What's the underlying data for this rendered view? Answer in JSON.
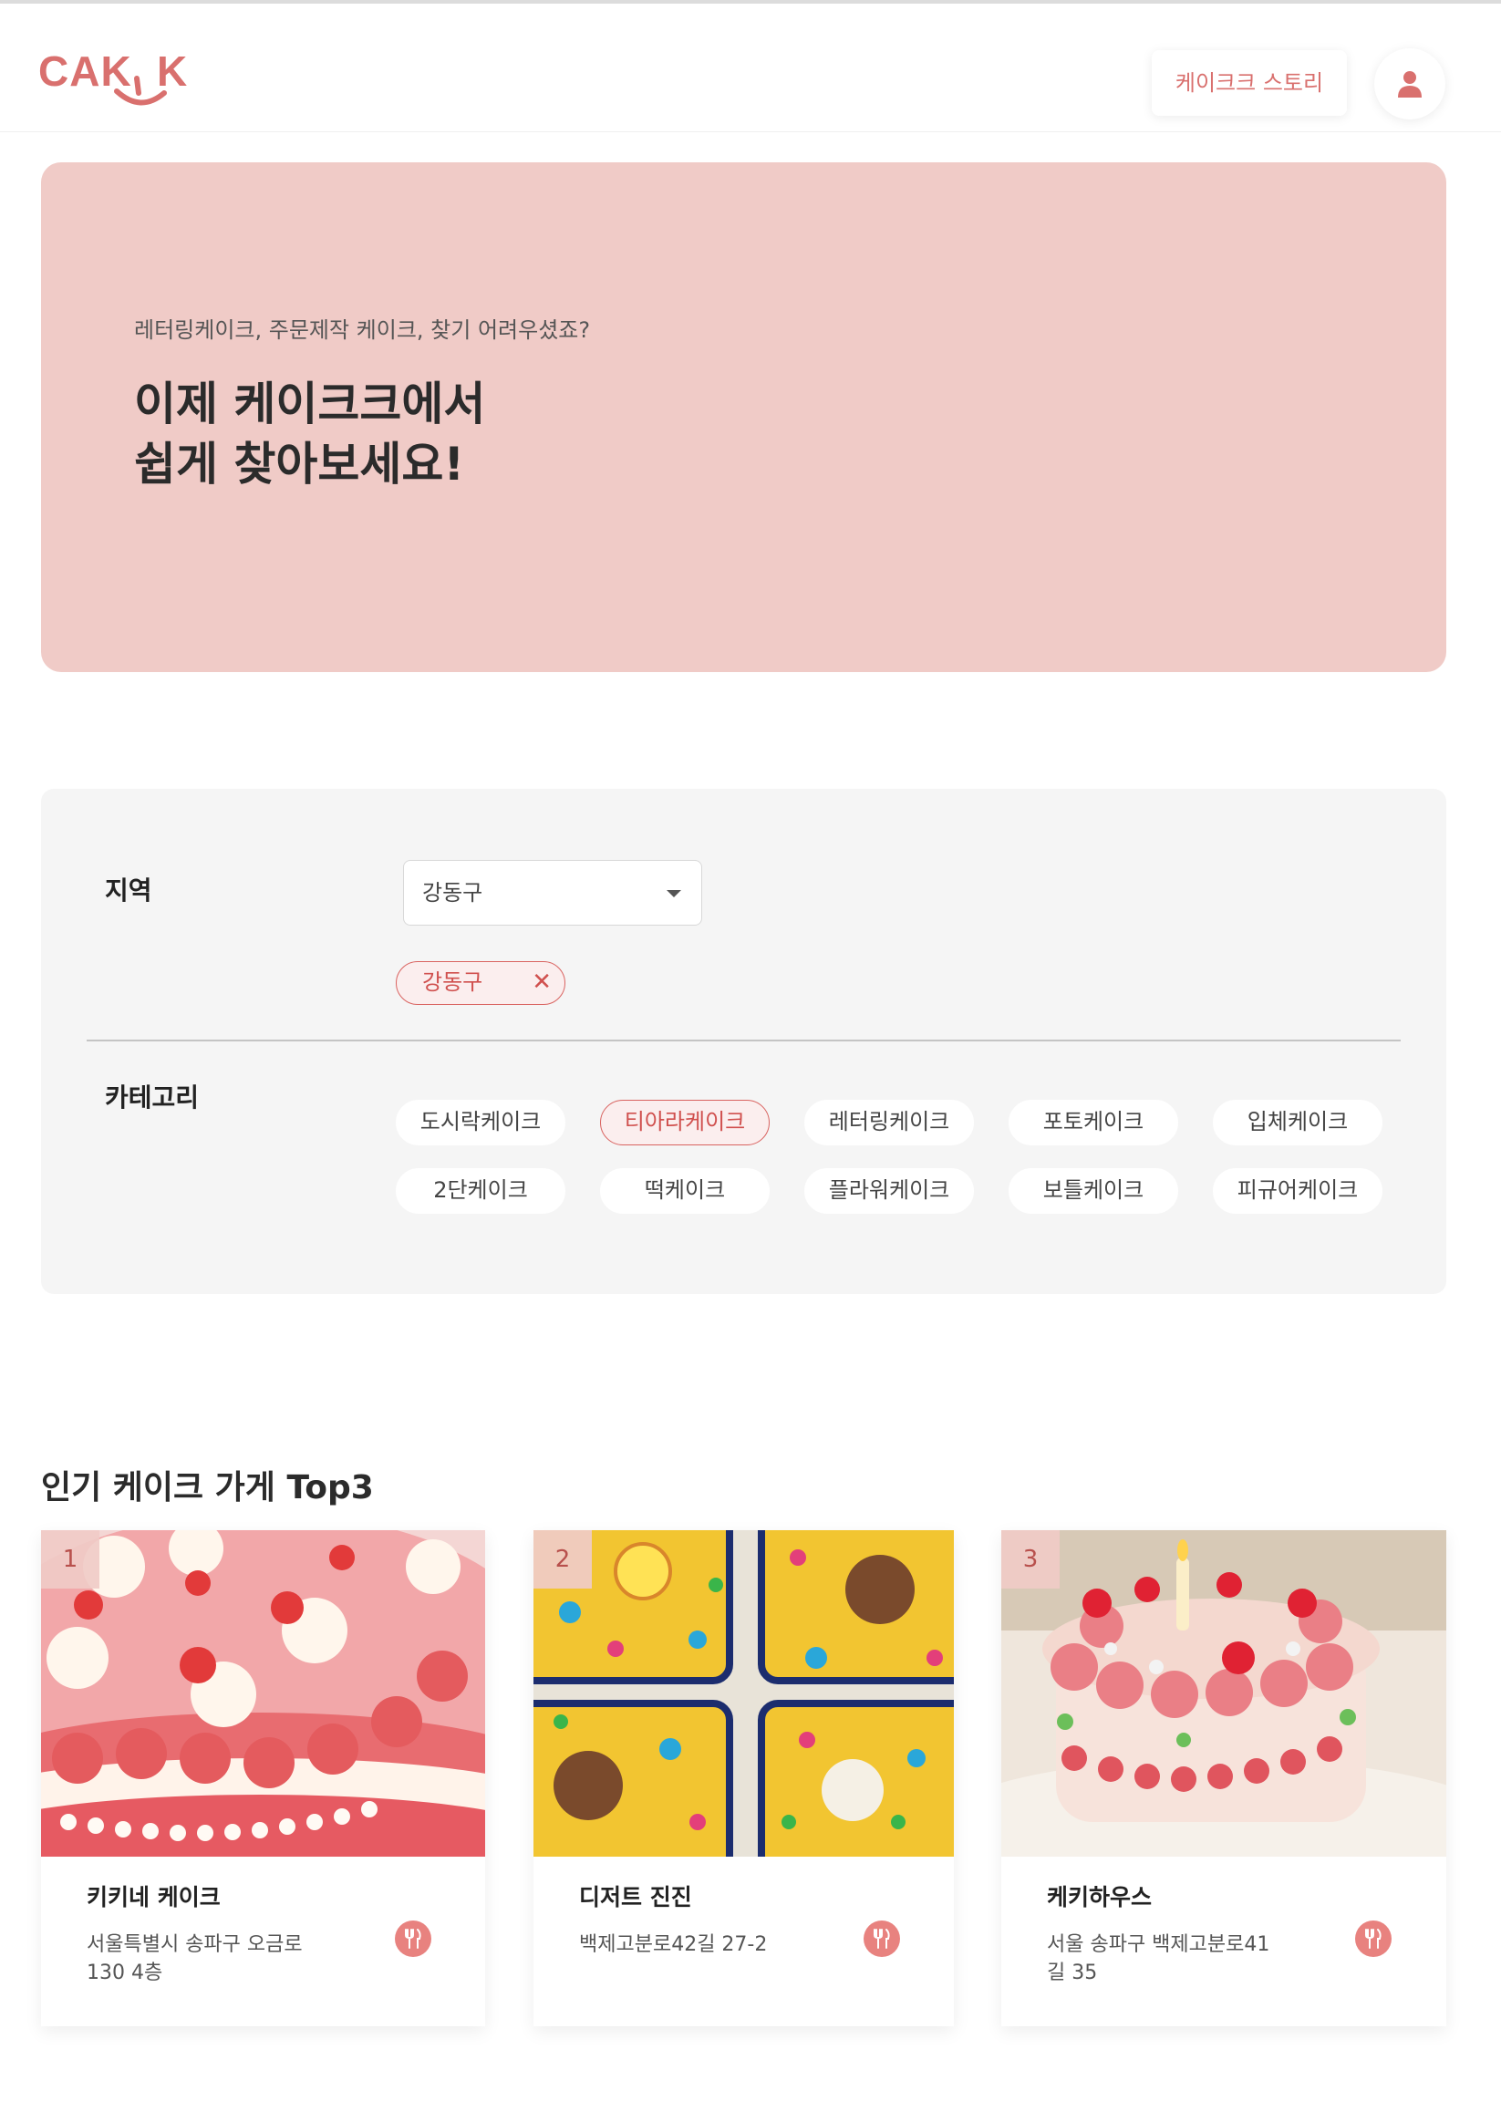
{
  "header": {
    "logo_text": "CAKEK",
    "story_button": "케이크크 스토리",
    "profile_icon": "user-icon"
  },
  "hero": {
    "subtitle": "레터링케이크, 주문제작 케이크, 찾기 어려우셨죠?",
    "title_line1": "이제 케이크크에서",
    "title_line2": "쉽게 찾아보세요!"
  },
  "filter": {
    "region_label": "지역",
    "region_select": {
      "value": "강동구",
      "icon": "chevron-down-icon"
    },
    "selected_regions": [
      {
        "label": "강동구",
        "remove_icon": "close-icon"
      }
    ],
    "category_label": "카테고리",
    "categories": [
      {
        "label": "도시락케이크",
        "selected": false
      },
      {
        "label": "티아라케이크",
        "selected": true
      },
      {
        "label": "레터링케이크",
        "selected": false
      },
      {
        "label": "포토케이크",
        "selected": false
      },
      {
        "label": "입체케이크",
        "selected": false
      },
      {
        "label": "2단케이크",
        "selected": false
      },
      {
        "label": "떡케이크",
        "selected": false
      },
      {
        "label": "플라워케이크",
        "selected": false
      },
      {
        "label": "보틀케이크",
        "selected": false
      },
      {
        "label": "피규어케이크",
        "selected": false
      }
    ]
  },
  "top3": {
    "title": "인기 케이크 가게 Top3",
    "stores": [
      {
        "rank": "1",
        "name": "키키네 케이크",
        "address": "서울특별시 송파구 오금로 130 4층",
        "icon": "fork-knife-icon"
      },
      {
        "rank": "2",
        "name": "디저트 진진",
        "address": "백제고분로42길 27-2",
        "icon": "fork-knife-icon"
      },
      {
        "rank": "3",
        "name": "케키하우스",
        "address": "서울 송파구 백제고분로41길 35",
        "icon": "fork-knife-icon"
      }
    ]
  },
  "colors": {
    "brand": "#d9706e",
    "hero_bg": "#f0cbc7",
    "panel_bg": "#f5f5f5",
    "chip_active": "#d96360"
  }
}
